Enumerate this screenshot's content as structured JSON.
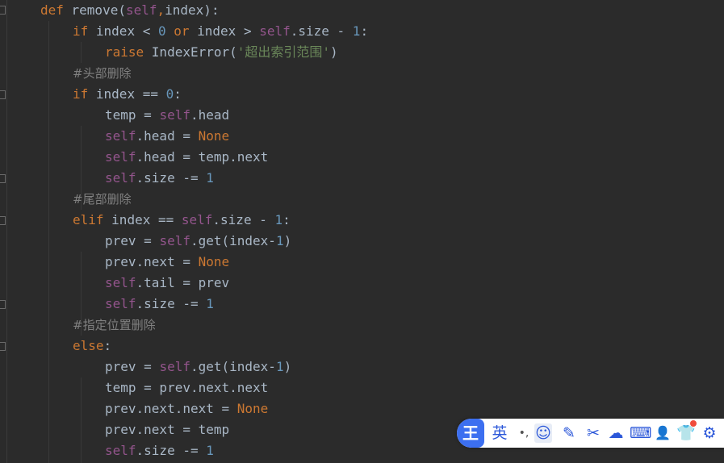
{
  "code_lines": [
    [
      {
        "t": "def ",
        "c": "kw"
      },
      {
        "t": "remove(",
        "c": ""
      },
      {
        "t": "self",
        "c": "sf"
      },
      {
        "t": ",",
        "c": "kw"
      },
      {
        "t": "index):",
        "c": ""
      }
    ],
    [
      {
        "t": "if ",
        "c": "kw"
      },
      {
        "t": "index < ",
        "c": ""
      },
      {
        "t": "0 ",
        "c": "num"
      },
      {
        "t": "or ",
        "c": "kw"
      },
      {
        "t": "index > ",
        "c": ""
      },
      {
        "t": "self",
        "c": "sf"
      },
      {
        "t": ".size - ",
        "c": ""
      },
      {
        "t": "1",
        "c": "num"
      },
      {
        "t": ":",
        "c": ""
      }
    ],
    [
      {
        "t": "raise ",
        "c": "kw"
      },
      {
        "t": "IndexError(",
        "c": ""
      },
      {
        "t": "'超出索引范围'",
        "c": "str"
      },
      {
        "t": ")",
        "c": ""
      }
    ],
    [
      {
        "t": "#头部删除",
        "c": "cm"
      }
    ],
    [
      {
        "t": "if ",
        "c": "kw"
      },
      {
        "t": "index == ",
        "c": ""
      },
      {
        "t": "0",
        "c": "num"
      },
      {
        "t": ":",
        "c": ""
      }
    ],
    [
      {
        "t": "temp = ",
        "c": ""
      },
      {
        "t": "self",
        "c": "sf"
      },
      {
        "t": ".head",
        "c": ""
      }
    ],
    [
      {
        "t": "self",
        "c": "sf"
      },
      {
        "t": ".head = ",
        "c": ""
      },
      {
        "t": "None",
        "c": "kw"
      }
    ],
    [
      {
        "t": "self",
        "c": "sf"
      },
      {
        "t": ".head = temp.next",
        "c": ""
      }
    ],
    [
      {
        "t": "self",
        "c": "sf"
      },
      {
        "t": ".size -= ",
        "c": ""
      },
      {
        "t": "1",
        "c": "num"
      }
    ],
    [
      {
        "t": "#尾部删除",
        "c": "cm"
      }
    ],
    [
      {
        "t": "elif ",
        "c": "kw"
      },
      {
        "t": "index == ",
        "c": ""
      },
      {
        "t": "self",
        "c": "sf"
      },
      {
        "t": ".size - ",
        "c": ""
      },
      {
        "t": "1",
        "c": "num"
      },
      {
        "t": ":",
        "c": ""
      }
    ],
    [
      {
        "t": "prev = ",
        "c": ""
      },
      {
        "t": "self",
        "c": "sf"
      },
      {
        "t": ".get(index-",
        "c": ""
      },
      {
        "t": "1",
        "c": "num"
      },
      {
        "t": ")",
        "c": ""
      }
    ],
    [
      {
        "t": "prev.next = ",
        "c": ""
      },
      {
        "t": "None",
        "c": "kw"
      }
    ],
    [
      {
        "t": "self",
        "c": "sf"
      },
      {
        "t": ".tail = prev",
        "c": ""
      }
    ],
    [
      {
        "t": "self",
        "c": "sf"
      },
      {
        "t": ".size -= ",
        "c": ""
      },
      {
        "t": "1",
        "c": "num"
      }
    ],
    [
      {
        "t": "#指定位置删除",
        "c": "cm"
      }
    ],
    [
      {
        "t": "else",
        "c": "kw"
      },
      {
        "t": ":",
        "c": ""
      }
    ],
    [
      {
        "t": "prev = ",
        "c": ""
      },
      {
        "t": "self",
        "c": "sf"
      },
      {
        "t": ".get(index-",
        "c": ""
      },
      {
        "t": "1",
        "c": "num"
      },
      {
        "t": ")",
        "c": ""
      }
    ],
    [
      {
        "t": "temp = prev.next.next",
        "c": ""
      }
    ],
    [
      {
        "t": "prev.next.next = ",
        "c": ""
      },
      {
        "t": "None",
        "c": "kw"
      }
    ],
    [
      {
        "t": "prev.next = temp",
        "c": ""
      }
    ],
    [
      {
        "t": "self",
        "c": "sf"
      },
      {
        "t": ".size -= ",
        "c": ""
      },
      {
        "t": "1",
        "c": "num"
      }
    ]
  ],
  "colors": {
    "background": "#2b2b2b",
    "default": "#a9b7c6",
    "keyword": "#cc7832",
    "number": "#6897bb",
    "string": "#6a8759",
    "comment": "#808080",
    "self": "#94558d",
    "ime_accent": "#3c6ff0"
  },
  "ime_toolbar": {
    "logo": "王",
    "language_label": "英",
    "punct_label": "•,",
    "buttons": [
      {
        "name": "emoji-icon",
        "glyph": "☺"
      },
      {
        "name": "handwrite-pen-icon",
        "glyph": "✎"
      },
      {
        "name": "scissors-icon",
        "glyph": "✂"
      },
      {
        "name": "cloud-icon",
        "glyph": "☁"
      },
      {
        "name": "keyboard-icon",
        "glyph": "⌨"
      },
      {
        "name": "user-icon",
        "glyph": "👤"
      },
      {
        "name": "skin-shirt-icon",
        "glyph": "👕"
      },
      {
        "name": "settings-gear-icon",
        "glyph": "⚙"
      }
    ]
  }
}
